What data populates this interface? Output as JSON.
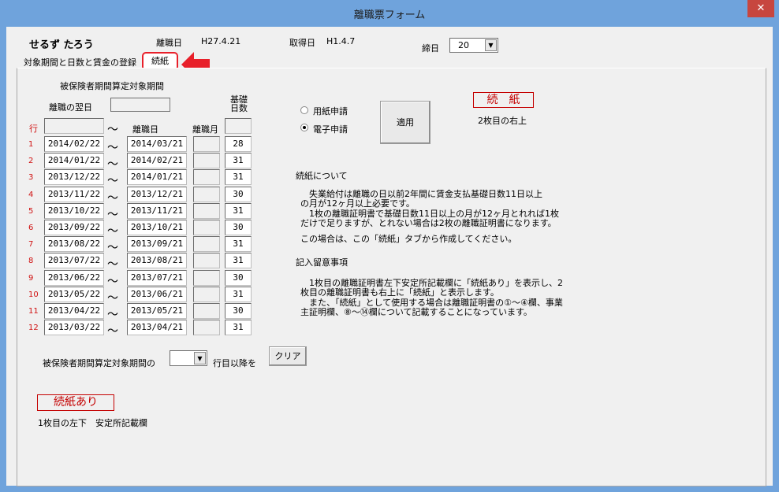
{
  "window": {
    "title": "離職票フォーム",
    "close_label": "✕"
  },
  "header": {
    "name": "せるず たろう",
    "rishoku_label": "離職日",
    "rishoku_value": "H27.4.21",
    "shutoku_label": "取得日",
    "shutoku_value": "H1.4.7",
    "shime_label": "締日",
    "shime_value": "20"
  },
  "tabs": [
    {
      "label": "対象期間と日数と賃金の登録"
    },
    {
      "label": "続紙"
    }
  ],
  "left": {
    "section_title": "被保険者期間算定対象期間",
    "yokujitsu_label": "離職の翌日",
    "col_kisoku": "基礎\n日数",
    "gyo_label": "行",
    "tilde": "～",
    "col_rishoku": "離職日",
    "col_rishokugetsu": "離職月",
    "rows": [
      {
        "no": "1",
        "from": "2014/02/22",
        "to": "2014/03/21",
        "days": "28"
      },
      {
        "no": "2",
        "from": "2014/01/22",
        "to": "2014/02/21",
        "days": "31"
      },
      {
        "no": "3",
        "from": "2013/12/22",
        "to": "2014/01/21",
        "days": "31"
      },
      {
        "no": "4",
        "from": "2013/11/22",
        "to": "2013/12/21",
        "days": "30"
      },
      {
        "no": "5",
        "from": "2013/10/22",
        "to": "2013/11/21",
        "days": "31"
      },
      {
        "no": "6",
        "from": "2013/09/22",
        "to": "2013/10/21",
        "days": "30"
      },
      {
        "no": "7",
        "from": "2013/08/22",
        "to": "2013/09/21",
        "days": "31"
      },
      {
        "no": "8",
        "from": "2013/07/22",
        "to": "2013/08/21",
        "days": "31"
      },
      {
        "no": "9",
        "from": "2013/06/22",
        "to": "2013/07/21",
        "days": "30"
      },
      {
        "no": "10",
        "from": "2013/05/22",
        "to": "2013/06/21",
        "days": "31"
      },
      {
        "no": "11",
        "from": "2013/04/22",
        "to": "2013/05/21",
        "days": "30"
      },
      {
        "no": "12",
        "from": "2013/03/22",
        "to": "2013/04/21",
        "days": "31"
      }
    ],
    "bottom_label1": "被保険者期間算定対象期間の",
    "bottom_label2": "行目以降を",
    "clear_label": "クリア",
    "zokushi_ari": "続紙あり",
    "zokushi_ari_note": "1枚目の左下　安定所記載欄"
  },
  "right": {
    "radio1": "用紙申請",
    "radio2": "電子申請",
    "apply_label": "適用",
    "zokushi_label": "続　紙",
    "zokushi_note": "2枚目の右上",
    "about_title": "続紙について",
    "about_lines": [
      "　失業給付は離職の日以前2年間に賃金支払基礎日数11日以上",
      "の月が12ヶ月以上必要です。",
      "　1枚の離職証明書で基礎日数11日以上の月が12ヶ月とれれば1枚",
      "だけで足りますが、とれない場合は2枚の離職証明書になります。"
    ],
    "about_line5": "この場合は、この「続紙」タブから作成してください。",
    "notes_title": "記入留意事項",
    "notes_lines": [
      "　1枚目の離職証明書左下安定所記載欄に「続紙あり」を表示し、2",
      "枚目の離職証明書も右上に「続紙」と表示します。",
      "　また、「続紙」として使用する場合は離職証明書の①～④欄、事業",
      "主証明欄、⑧～⑭欄について記載することになっています。"
    ]
  },
  "colors": {
    "accent_red": "#c40000",
    "titlebar": "#6fa3dc",
    "close": "#c7463f"
  }
}
